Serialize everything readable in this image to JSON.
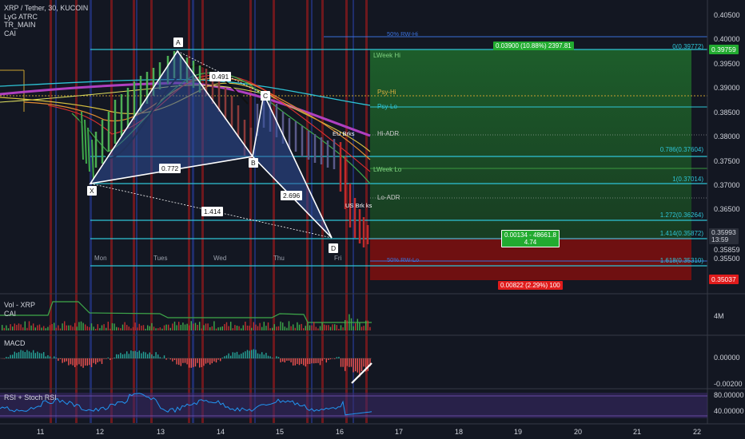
{
  "header": {
    "symbol": "XRP / Tether, 30, KUCOIN",
    "indicators": [
      "LyG ATRC",
      "TR_MAIN",
      "CAI"
    ]
  },
  "price_axis": {
    "ticks": [
      "0.40500",
      "0.40000",
      "0.39500",
      "0.39000",
      "0.38500",
      "0.38000",
      "0.37500",
      "0.37000",
      "0.36500",
      "0.35500",
      "0.35000"
    ],
    "current_price": "0.35993",
    "countdown": "13:59",
    "price_tag_2": "0.35859",
    "tp_price": "0.39759",
    "sl_price": "0.35037"
  },
  "day_labels": [
    "Mon",
    "Tues",
    "Wed",
    "Thu",
    "Fri"
  ],
  "date_axis": [
    "11",
    "12",
    "13",
    "14",
    "15",
    "16",
    "17",
    "18",
    "19",
    "20",
    "21",
    "22"
  ],
  "pattern": {
    "points": [
      "X",
      "A",
      "B",
      "C",
      "D"
    ],
    "ratios": [
      "0.491",
      "0.772",
      "2.696",
      "1.414"
    ]
  },
  "level_labels": {
    "week_hi": "LWeek Hi",
    "psy_hi": "Psy-Hi",
    "psy_lo": "Psy-Lo",
    "hi_adr": "Hi-ADR",
    "eu_brks": "EU Brks",
    "week_lo": "LWeek Lo",
    "lo_adr": "Lo-ADR",
    "us_brks": "US Brk ks",
    "rw_hi": "50% RW-Hi",
    "rw_lo": "50% RW-Lo"
  },
  "fib_labels": [
    "0(0.39772)",
    "0.786(0.37604)",
    "1(0.37014)",
    "1.272(0.36264)",
    "1.414(0.35872)",
    "1.618(0.35310)"
  ],
  "position": {
    "target": "0.03900 (10.88%) 2397.81",
    "entry_line1": "0.00134 - 48661.8",
    "entry_line2": "4.74",
    "stop": "0.00822 (2.29%) 100"
  },
  "panes": {
    "volume": {
      "title": "Vol - XRP",
      "sub": "CAI",
      "axis": "4M"
    },
    "macd": {
      "title": "MACD",
      "ticks": [
        "0.00000",
        "-0.00200"
      ]
    },
    "rsi": {
      "title": "RSI + Stoch RSI",
      "ticks": [
        "80.00000",
        "40.00000"
      ]
    }
  },
  "colors": {
    "background": "#131722",
    "pattern_fill": "#2f4f9a",
    "target_zone": "#1e5a2a",
    "stop_zone": "#7a1010",
    "tp_tag": "#22ab30",
    "sl_tag": "#e01b1b",
    "level_line": "#2ec4d6",
    "vertical_red": "#b81919",
    "vertical_blue": "#2a3fa8"
  }
}
